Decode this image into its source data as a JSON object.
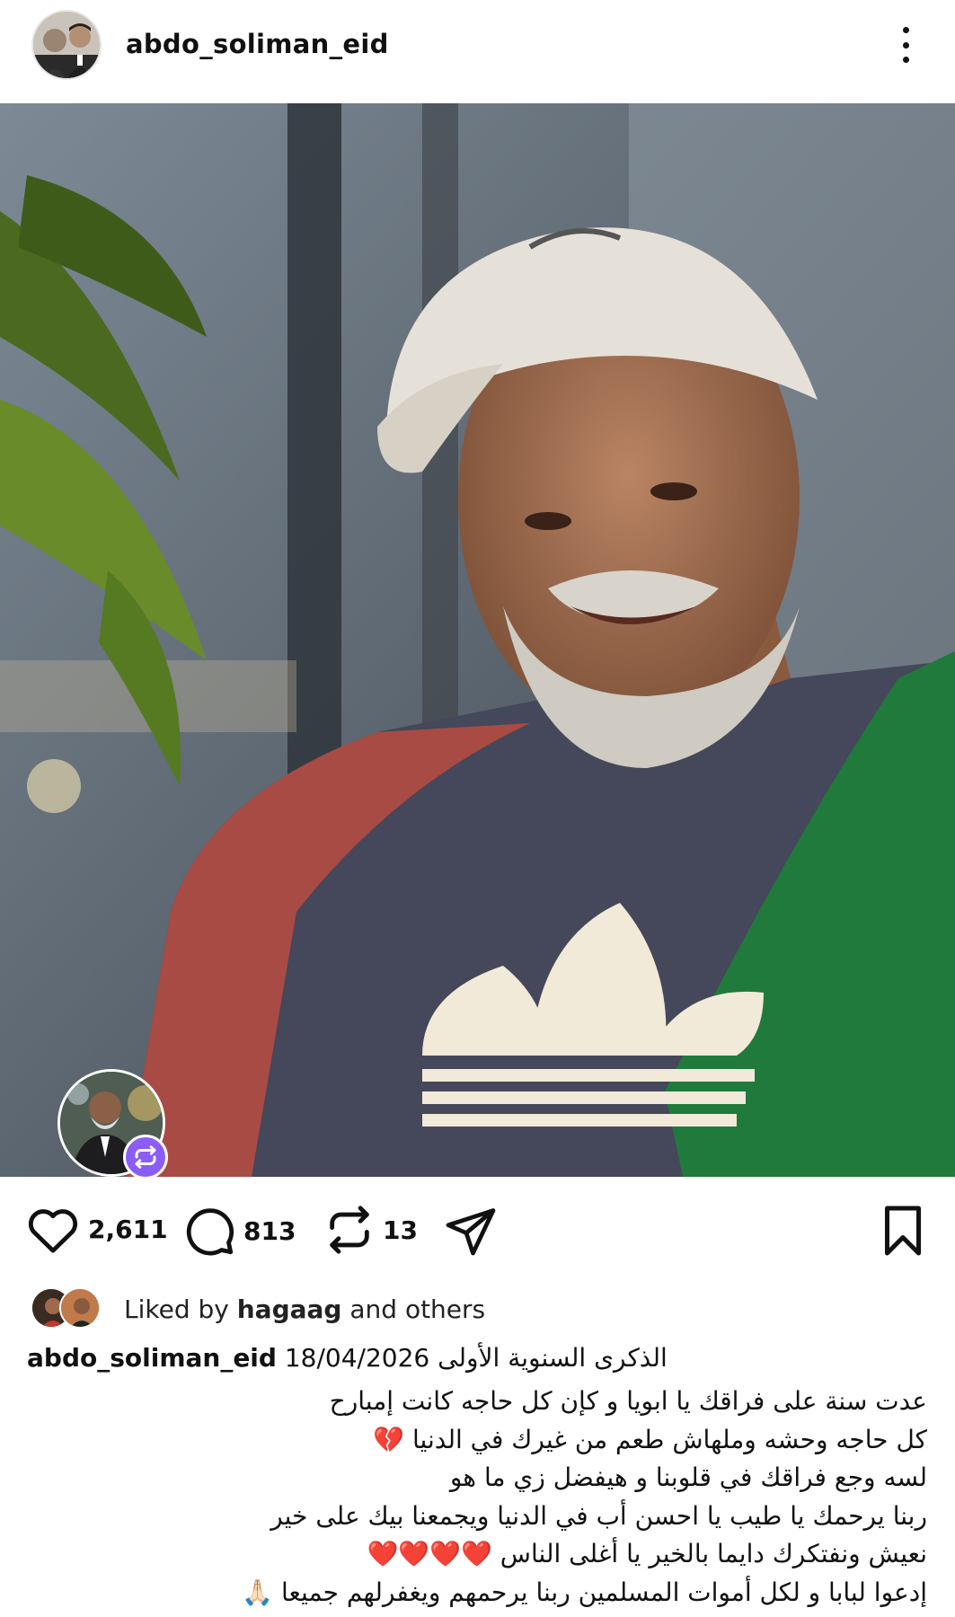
{
  "post": {
    "username": "abdo_soliman_eid",
    "more_icon": "more-vertical-icon"
  },
  "actions": {
    "likes": "2,611",
    "comments": "813",
    "reposts": "13"
  },
  "liked_by": {
    "prefix": "Liked by",
    "user": "hagaag",
    "suffix": "and others"
  },
  "caption": {
    "username": "abdo_soliman_eid",
    "date": "18/04/2026",
    "title": "الذكرى السنوية الأولى",
    "lines": [
      "عدت سنة على فراقك يا ابويا و كإن كل حاجه كانت إمبارح",
      "كل حاجه وحشه وملهاش طعم من غيرك في الدنيا 💔",
      "لسه وجع فراقك في قلوبنا و هيفضل زي ما هو",
      "ربنا يرحمك يا طيب يا احسن أب في الدنيا ويجمعنا بيك على خير",
      "نعيش ونفتكرك دايما بالخير يا أغلى الناس ❤️❤️❤️❤️",
      "إدعوا لبابا و لكل أموات المسلمين ربنا يرحمهم ويغفرلهم جميعا 🙏🏻"
    ]
  },
  "colors": {
    "repost_badge": "#8b5cf6",
    "text": "#111111",
    "background": "#ffffff"
  }
}
